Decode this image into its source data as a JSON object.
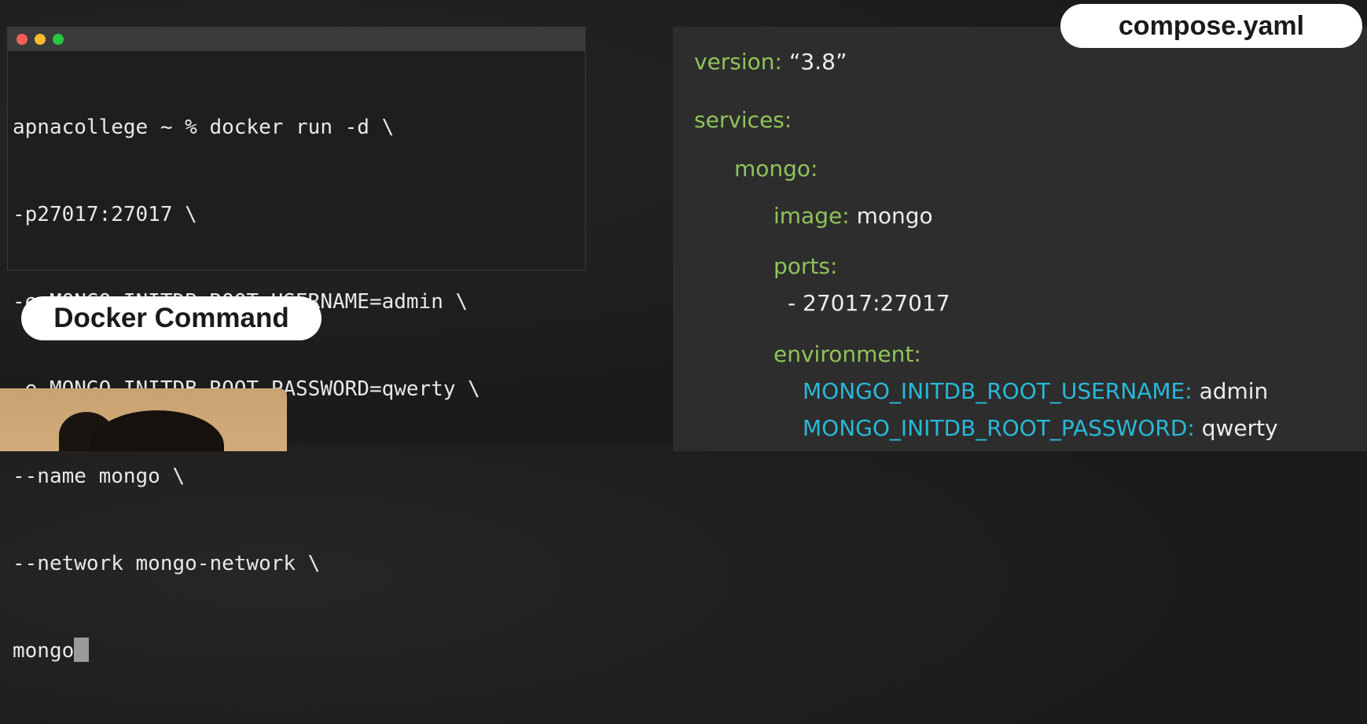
{
  "terminal": {
    "lines": [
      "apnacollege ~ % docker run -d \\",
      "-p27017:27017 \\",
      "-e MONGO_INITDB_ROOT_USERNAME=admin \\",
      "-e MONGO_INITDB_ROOT_PASSWORD=qwerty \\",
      "--name mongo \\",
      "--network mongo-network \\",
      "mongo"
    ]
  },
  "labels": {
    "docker_command": "Docker Command",
    "compose_file": "compose.yaml"
  },
  "compose": {
    "version_key": "version:",
    "version_value": "“3.8”",
    "services_key": "services:",
    "mongo_key": "mongo:",
    "image_key": "image:",
    "image_value": "mongo",
    "ports_key": "ports:",
    "ports_item": "- 27017:27017",
    "environment_key": "environment:",
    "env_username_key": "MONGO_INITDB_ROOT_USERNAME:",
    "env_username_value": "admin",
    "env_password_key": "MONGO_INITDB_ROOT_PASSWORD:",
    "env_password_value": "qwerty"
  },
  "colors": {
    "yaml_key": "#8fc35a",
    "yaml_env_key": "#28b9d8",
    "yaml_value": "#ececec",
    "terminal_bg": "#1e1e1e",
    "panel_bg": "#2d2d2d",
    "pill_bg": "#ffffff"
  }
}
